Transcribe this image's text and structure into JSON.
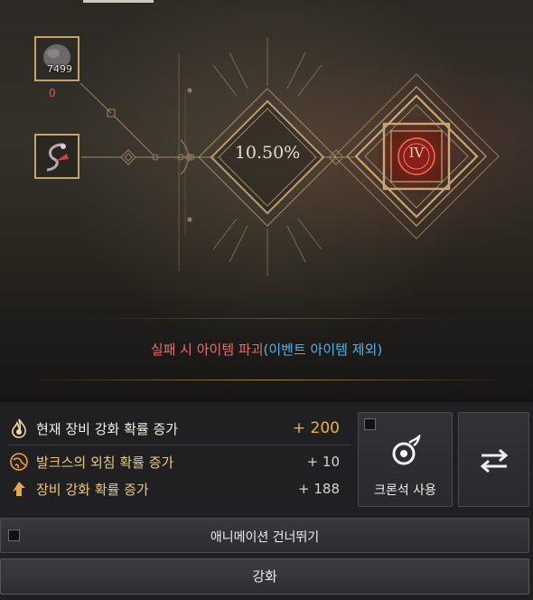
{
  "materials": {
    "stone": {
      "icon": "leapstone-icon",
      "count": "7499",
      "required": "0"
    },
    "weapon": {
      "icon": "chain-weapon-icon"
    }
  },
  "enhance": {
    "rate": "10.50%",
    "tier": "IV"
  },
  "warning": {
    "main": "실패 시 아이템 파괴",
    "note": "(이벤트 아이템 제외)"
  },
  "bonuses": [
    {
      "icon": "flame-icon",
      "label": "현재 장비 강화 확률 증가",
      "value": "+ 200"
    },
    {
      "icon": "globe-icon",
      "label": "발크스의 외침 확률 증가",
      "value": "+ 10"
    },
    {
      "icon": "up-arrow-icon",
      "label": "장비 강화 확률 증가",
      "value": "+ 188"
    }
  ],
  "buttons": {
    "crown_label": "크론석 사용",
    "skip_label": "애니메이션 건너뛰기",
    "enhance_label": "강화"
  },
  "colors": {
    "gold": "#c3a46a",
    "warning_red": "#ea6b72",
    "note_blue": "#4fb4e8",
    "value_orange": "#f0b040"
  }
}
